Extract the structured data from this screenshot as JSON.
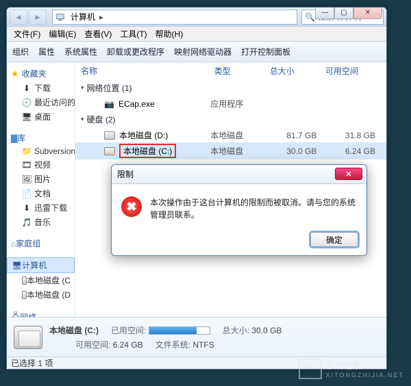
{
  "titlebar": {
    "breadcrumb_root": "计算机",
    "search_placeholder": "搜索 计算机"
  },
  "menu": {
    "file": "文件(F)",
    "edit": "编辑(E)",
    "view": "查看(V)",
    "tools": "工具(T)",
    "help": "帮助(H)"
  },
  "toolbar": {
    "organize": "组织",
    "properties": "属性",
    "system_props": "系统属性",
    "uninstall": "卸载或更改程序",
    "map_drive": "映射网络驱动器",
    "control_panel": "打开控制面板"
  },
  "columns": {
    "name": "名称",
    "type": "类型",
    "total": "总大小",
    "free": "可用空间"
  },
  "groups": {
    "network_loc": "网络位置 (1)",
    "hard_disk": "硬盘 (2)"
  },
  "items": {
    "ecap": {
      "name": "ECap.exe",
      "type": "应用程序"
    },
    "disk_d": {
      "name": "本地磁盘 (D:)",
      "type": "本地磁盘",
      "total": "81.7 GB",
      "free": "31.8 GB"
    },
    "disk_c": {
      "name": "本地磁盘 (C:)",
      "type": "本地磁盘",
      "total": "30.0 GB",
      "free": "6.24 GB"
    }
  },
  "tree": {
    "favorites": "收藏夹",
    "downloads": "下载",
    "recent": "最近访问的",
    "desktop": "桌面",
    "libraries": "库",
    "subversion": "Subversion",
    "videos": "视频",
    "pictures": "图片",
    "documents": "文档",
    "xunlei": "迅雷下载",
    "music": "音乐",
    "homegroup": "家庭组",
    "computer": "计算机",
    "local_c": "本地磁盘 (C",
    "local_d": "本地磁盘 (D",
    "network": "网络"
  },
  "details": {
    "title": "本地磁盘 (C:)",
    "used_label": "已用空间:",
    "free_label": "可用空间:",
    "free_val": "6.24 GB",
    "total_label": "总大小:",
    "total_val": "30.0 GB",
    "fs_label": "文件系统:",
    "fs_val": "NTFS",
    "bar_pct": 79
  },
  "status": {
    "text": "已选择 1 项"
  },
  "dialog": {
    "title": "限制",
    "message": "本次操作由于这台计算机的限制而被取消。请与您的系统管理员联系。",
    "ok": "确定"
  },
  "watermark": {
    "brand": "系统之家",
    "url": "XITONGZHIJIA.NET"
  }
}
